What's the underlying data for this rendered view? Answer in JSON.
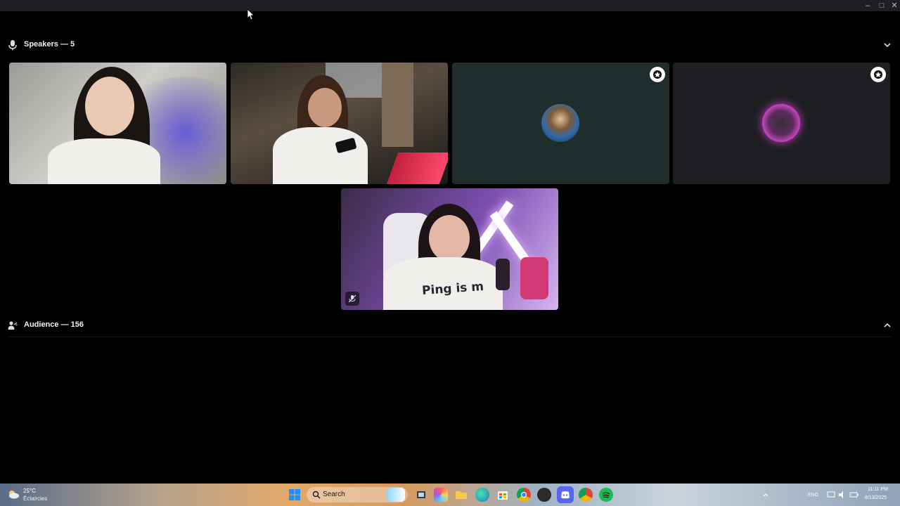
{
  "window": {
    "controls": {
      "minimize": "–",
      "maximize": "□",
      "close": "✕"
    }
  },
  "speakers": {
    "title": "Speakers — 5",
    "icon": "microphone-icon",
    "toggle_icon": "chevron-down-icon"
  },
  "tiles": [
    {
      "name": "speaker-video-1",
      "type": "video"
    },
    {
      "name": "speaker-video-2",
      "type": "video"
    },
    {
      "name": "speaker-avatar-3",
      "type": "avatar",
      "badge_icon": "stage-moderator-icon"
    },
    {
      "name": "speaker-avatar-4",
      "type": "avatar",
      "badge_icon": "stage-moderator-icon"
    },
    {
      "name": "speaker-video-5",
      "type": "video",
      "shirt_text": "Ping is m",
      "status_icon": "muted-mic-icon"
    }
  ],
  "audience": {
    "title": "Audience — 156",
    "icon": "audience-icon",
    "toggle_icon": "chevron-up-icon"
  },
  "taskbar": {
    "weather": {
      "temp": "25°C",
      "condition": "Éclaircies"
    },
    "search_placeholder": "Search",
    "tray": {
      "language": "ENG",
      "time": "11:11 PM",
      "date": "8/13/2025"
    }
  },
  "colors": {
    "background": "#000000",
    "tile_teal": "#1f2d2c",
    "tile_dark": "#1e1f22",
    "avatar_glow": "#c93dd0"
  }
}
